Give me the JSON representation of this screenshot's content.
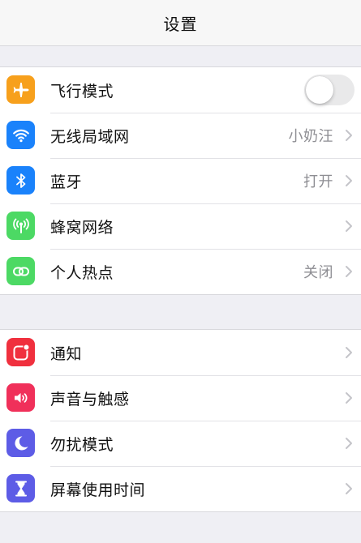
{
  "header": {
    "title": "设置"
  },
  "groups": [
    {
      "items": [
        {
          "label": "飞行模式",
          "icon": "airplane-icon",
          "color": "#f7a01c",
          "control": "toggle",
          "toggle_on": false
        },
        {
          "label": "无线局域网",
          "icon": "wifi-icon",
          "color": "#1a82fb",
          "value": "小奶汪"
        },
        {
          "label": "蓝牙",
          "icon": "bluetooth-icon",
          "color": "#1a82fb",
          "value": "打开"
        },
        {
          "label": "蜂窝网络",
          "icon": "cellular-antenna-icon",
          "color": "#4cd964",
          "value": ""
        },
        {
          "label": "个人热点",
          "icon": "personal-hotspot-icon",
          "color": "#4cd964",
          "value": "关闭"
        }
      ]
    },
    {
      "items": [
        {
          "label": "通知",
          "icon": "notification-icon",
          "color": "#f0303e",
          "value": ""
        },
        {
          "label": "声音与触感",
          "icon": "speaker-icon",
          "color": "#f0305a",
          "value": ""
        },
        {
          "label": "勿扰模式",
          "icon": "moon-icon",
          "color": "#5d5ce6",
          "value": ""
        },
        {
          "label": "屏幕使用时间",
          "icon": "hourglass-icon",
          "color": "#5d5ce6",
          "value": ""
        }
      ]
    }
  ]
}
